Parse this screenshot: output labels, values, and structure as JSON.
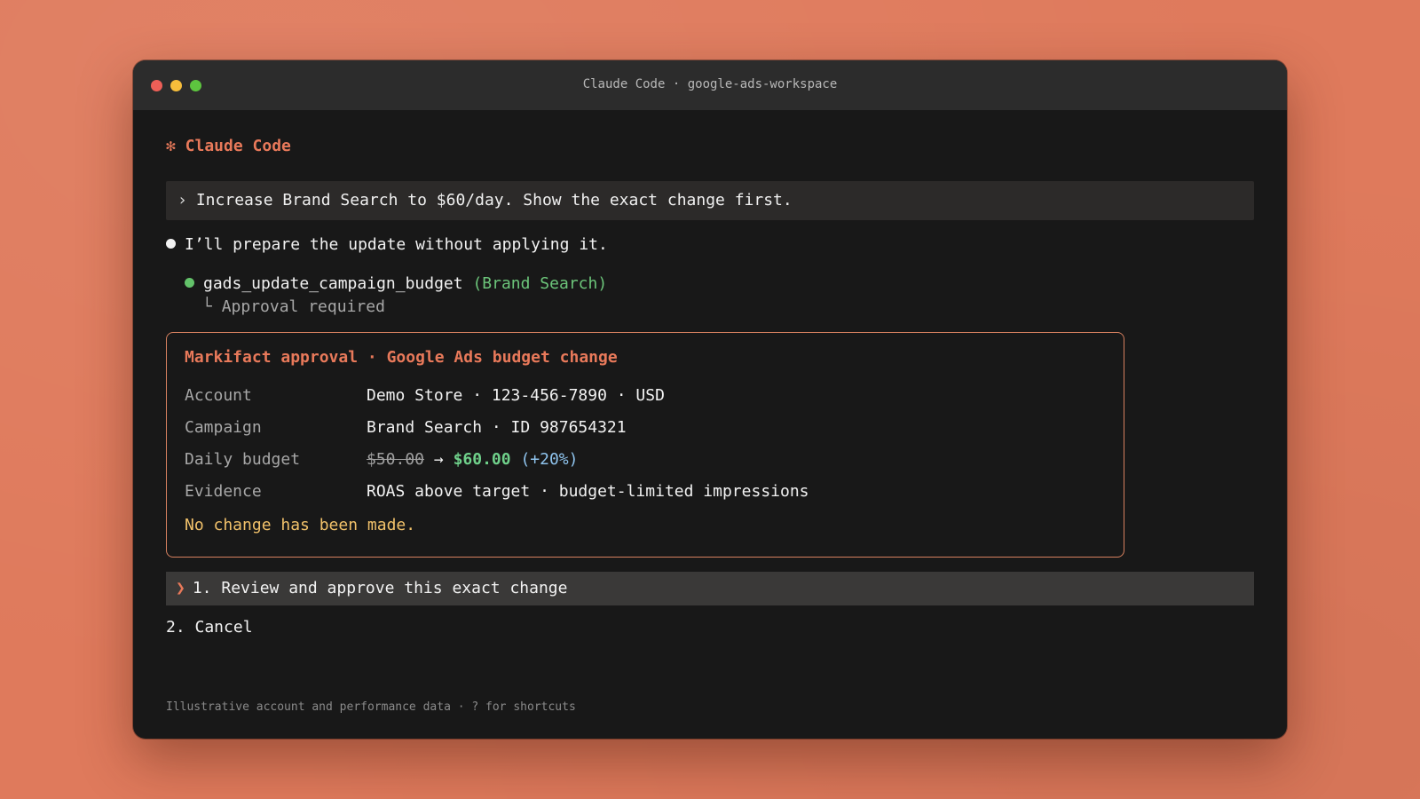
{
  "window": {
    "title": "Claude Code · google-ads-workspace"
  },
  "app": {
    "name": "✻ Claude Code"
  },
  "prompt": {
    "chevron": "›",
    "text": "Increase Brand Search to $60/day. Show the exact change first."
  },
  "assistant": {
    "message": "I’ll prepare the update without applying it."
  },
  "tool": {
    "name": "gads_update_campaign_budget",
    "arg": "(Brand Search)",
    "status_prefix": "└",
    "status": "Approval required"
  },
  "approval": {
    "title": "Markifact approval · Google Ads budget change",
    "account_label": "Account",
    "account_value": "Demo Store · 123-456-7890 · USD",
    "campaign_label": "Campaign",
    "campaign_value": "Brand Search · ID 987654321",
    "budget_label": "Daily budget",
    "budget_old": "$50.00",
    "budget_arrow": "→",
    "budget_new": "$60.00",
    "budget_pct": "(+20%)",
    "evidence_label": "Evidence",
    "evidence_value": "ROAS above target · budget-limited impressions",
    "notice": "No change has been made."
  },
  "options": [
    {
      "chevron": "❯",
      "label": "1. Review and approve this exact change"
    },
    {
      "label": "2. Cancel"
    }
  ],
  "footer": {
    "text": "Illustrative account and performance data · ? for shortcuts"
  },
  "colors": {
    "accent": "#e8795a",
    "success": "#6fd08a",
    "warning": "#f1c16a",
    "background": "#df7a5c"
  }
}
